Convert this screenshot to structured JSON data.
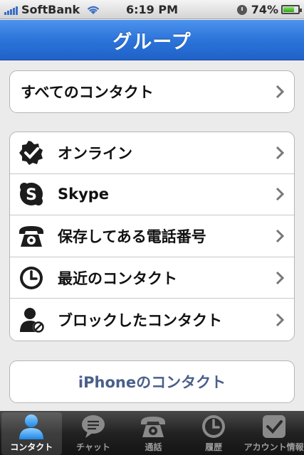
{
  "status_bar": {
    "carrier": "SoftBank",
    "time": "6:19 PM",
    "battery": "74%",
    "battery_level": 0.74
  },
  "nav": {
    "title": "グループ"
  },
  "group_all": {
    "label": "すべてのコンタクト"
  },
  "group_list": [
    {
      "label": "オンライン",
      "icon": "online-check-icon"
    },
    {
      "label": "Skype",
      "icon": "skype-icon"
    },
    {
      "label": "保存してある電話番号",
      "icon": "phone-icon"
    },
    {
      "label": "最近のコンタクト",
      "icon": "clock-icon"
    },
    {
      "label": "ブロックしたコンタクト",
      "icon": "blocked-user-icon"
    }
  ],
  "iphone_contacts": {
    "label": "iPhoneのコンタクト"
  },
  "tabs": [
    {
      "label": "コンタクト",
      "icon": "contacts-icon",
      "active": true
    },
    {
      "label": "チャット",
      "icon": "chat-icon",
      "active": false
    },
    {
      "label": "通話",
      "icon": "phone-icon",
      "active": false
    },
    {
      "label": "履歴",
      "icon": "history-icon",
      "active": false
    },
    {
      "label": "アカウント情報",
      "icon": "account-icon",
      "active": false
    }
  ],
  "colors": {
    "nav_blue": "#2c74d9",
    "link_text": "#4a5f8a",
    "tab_active_icon": "#3b9df2"
  }
}
